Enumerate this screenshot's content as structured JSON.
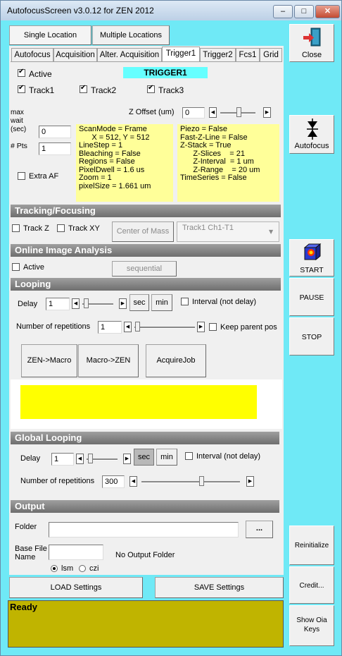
{
  "window": {
    "title": "AutofocusScreen v3.0.12 for ZEN 2012",
    "min": "–",
    "max": "□",
    "close": "✕"
  },
  "location_tabs": [
    "Single Location",
    "Multiple Locations"
  ],
  "tabs": [
    "Autofocus",
    "Acquisition",
    "Alter. Acquisition",
    "Trigger1",
    "Trigger2",
    "Fcs1",
    "Grid"
  ],
  "active_tab": "Trigger1",
  "trigger": {
    "header": "TRIGGER1",
    "active_label": "Active",
    "tracks": [
      "Track1",
      "Track2",
      "Track3"
    ],
    "max_wait_label": "max\nwait\n(sec)",
    "max_wait_value": "0",
    "pts_label": "# Pts",
    "pts_value": "1",
    "extra_af_label": "Extra AF",
    "z_offset_label": "Z Offset (um)",
    "z_offset_value": "0",
    "info_left": "ScanMode = Frame\n      X = 512, Y = 512\nLineStep = 1\nBleaching = False\nRegions = False\nPixelDwell = 1.6 us\nZoom = 1\npixelSize = 1.661 um",
    "info_right": "Piezo = False\nFast-Z-Line = False\nZ-Stack = True\n      Z-Slices    = 21\n      Z-Interval  = 1 um\n      Z-Range    = 20 um\nTimeSeries = False"
  },
  "tracking": {
    "title": "Tracking/Focusing",
    "track_z": "Track Z",
    "track_xy": "Track XY",
    "center_button": "Center of Mass",
    "channel_value": "Track1 Ch1-T1"
  },
  "oia": {
    "title": "Online Image Analysis",
    "active_label": "Active",
    "mode_button": "sequential"
  },
  "looping": {
    "title": "Looping",
    "delay_label": "Delay",
    "delay_value": "1",
    "sec": "sec",
    "min": "min",
    "interval_label": "Interval (not delay)",
    "reps_label": "Number of repetitions",
    "reps_value": "1",
    "keep_parent_label": "Keep parent pos",
    "zen_macro": "ZEN->Macro",
    "macro_zen": "Macro->ZEN",
    "acquire_job": "AcquireJob"
  },
  "global_looping": {
    "title": "Global Looping",
    "delay_label": "Delay",
    "delay_value": "1",
    "sec": "sec",
    "min": "min",
    "interval_label": "Interval (not delay)",
    "reps_label": "Number of repetitions",
    "reps_value": "300"
  },
  "output": {
    "title": "Output",
    "folder_label": "Folder",
    "browse": "...",
    "base_file_label": "Base File\nName",
    "no_folder": "No Output Folder",
    "format_lsm": "lsm",
    "format_czi": "czi"
  },
  "settings": {
    "load": "LOAD Settings",
    "save": "SAVE Settings"
  },
  "status": "Ready",
  "side": {
    "close": "Close",
    "autofocus": "Autofocus",
    "start": "START",
    "pause": "PAUSE",
    "stop": "STOP",
    "reinitialize": "Reinitialize",
    "credit": "Credit...",
    "show_oia": "Show Oia\nKeys"
  },
  "colors": {
    "window_bg": "#6fe9f6",
    "header_cyan": "#66ffff",
    "info_yellow": "#ffff99",
    "status_olive": "#c0b400",
    "yellow_box": "#ffff00"
  }
}
